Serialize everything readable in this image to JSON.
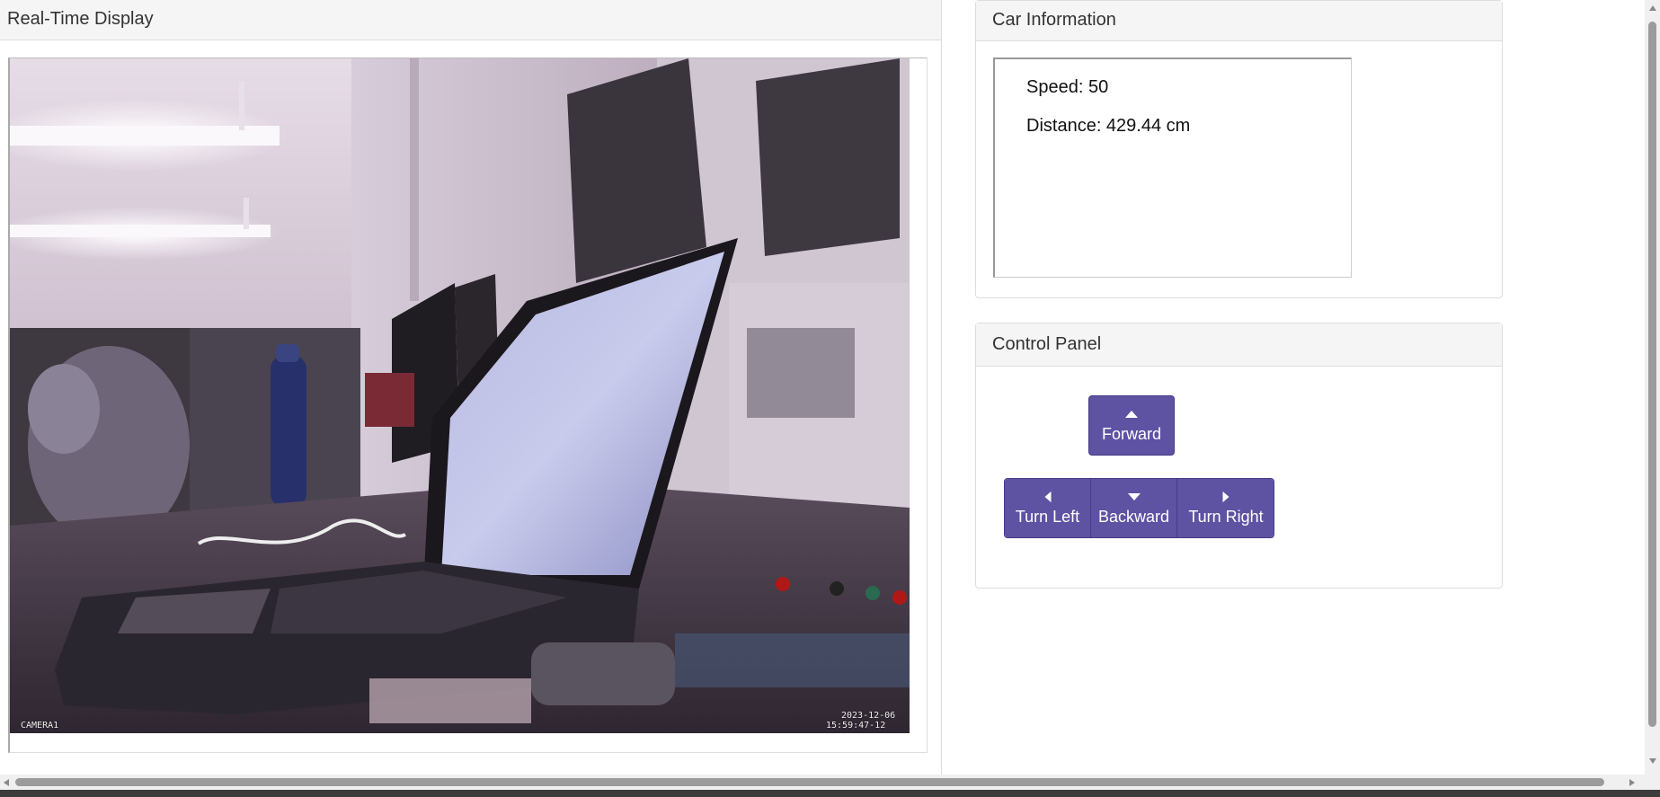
{
  "realtime": {
    "title": "Real-Time Display",
    "camera_label": "CAMERA1",
    "date": "2023-12-06",
    "time": "15:59:47-12"
  },
  "car_info": {
    "title": "Car Information",
    "speed": "Speed: 50",
    "distance": "Distance: 429.44 cm"
  },
  "control": {
    "title": "Control Panel",
    "forward": "Forward",
    "turn_left": "Turn Left",
    "backward": "Backward",
    "turn_right": "Turn Right",
    "button_color": "#5e52a3"
  },
  "icons": {
    "forward": "caret-up-icon",
    "left": "caret-left-icon",
    "backward": "caret-down-icon",
    "right": "caret-right-icon"
  }
}
